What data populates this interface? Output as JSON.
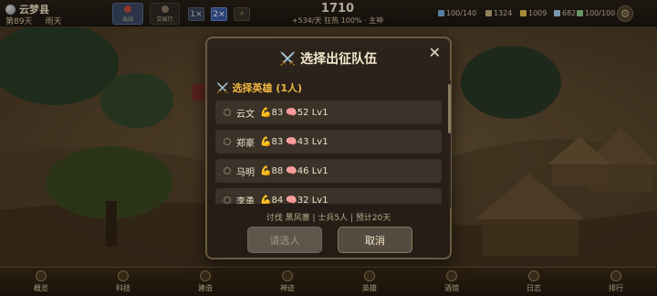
{
  "topbar": {
    "county": "云梦县",
    "day": "第89天",
    "weather": "雨天",
    "btn_war": "出战",
    "btn_treasury": "交易行",
    "speeds": [
      "1×",
      "2×",
      "⚡"
    ],
    "gold": "1710",
    "income_line": "+534/天 狂热 100%  ·  主神",
    "resources": [
      {
        "value": "100/140",
        "color": "#7ab0e0"
      },
      {
        "value": "1324",
        "color": "#c9b27e"
      },
      {
        "value": "1009",
        "color": "#e8c24a"
      },
      {
        "value": "682",
        "color": "#a8d0f0"
      },
      {
        "value": "100/100",
        "color": "#8fd08f"
      }
    ],
    "settings_icon": "gear-icon"
  },
  "modal": {
    "title": "⚔️ 选择出征队伍",
    "close": "✕",
    "section": "⚔️ 选择英雄 (1人)",
    "heroes": [
      {
        "name": "云文",
        "stats": "💪83 🧠52 Lv1"
      },
      {
        "name": "郑豪",
        "stats": "💪83 🧠43 Lv1"
      },
      {
        "name": "马明",
        "stats": "💪88 🧠46 Lv1"
      },
      {
        "name": "李勇",
        "stats": "💪84 🧠32 Lv1"
      }
    ],
    "summary": "讨伐 黑风寨 | 士兵5人 | 预计20天",
    "pick_label": "请选人",
    "cancel_label": "取消"
  },
  "nav": [
    "概览",
    "科技",
    "建造",
    "神迹",
    "英雄",
    "酒馆",
    "日志",
    "排行"
  ],
  "colors": {
    "accent": "#f0b844",
    "panel": "#2c231b",
    "border": "#6b5a3e"
  }
}
